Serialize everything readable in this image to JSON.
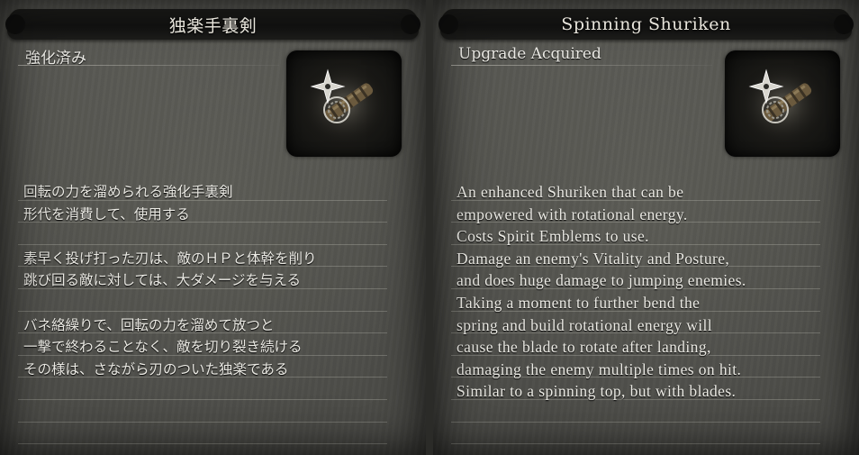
{
  "left_card": {
    "title": "独楽手裏剣",
    "status": "強化済み",
    "icon": "spinning-shuriken-prosthetic-icon",
    "lines": [
      "回転の力を溜められる強化手裏剣",
      "形代を消費して、使用する",
      "",
      "素早く投げ打った刃は、敵のＨＰと体幹を削り",
      "跳び回る敵に対しては、大ダメージを与える",
      "",
      "バネ絡繰りで、回転の力を溜めて放つと",
      "一撃で終わることなく、敵を切り裂き続ける",
      "その様は、さながら刃のついた独楽である",
      "",
      "",
      ""
    ]
  },
  "right_card": {
    "title": "Spinning Shuriken",
    "status": "Upgrade Acquired",
    "icon": "spinning-shuriken-prosthetic-icon",
    "lines": [
      "An enhanced Shuriken that can be",
      "empowered with rotational energy.",
      "Costs Spirit Emblems to use.",
      "Damage an enemy's Vitality and Posture,",
      "and does huge damage to jumping enemies.",
      "Taking a moment to further bend the",
      "spring and build rotational energy will",
      "cause the blade to rotate after landing,",
      "damaging the enemy multiple times on hit.",
      "Similar to a spinning top, but with blades.",
      "",
      ""
    ]
  },
  "colors": {
    "parchment": "#52524d",
    "title_bar": "#141413",
    "text": "#ebeae4"
  }
}
